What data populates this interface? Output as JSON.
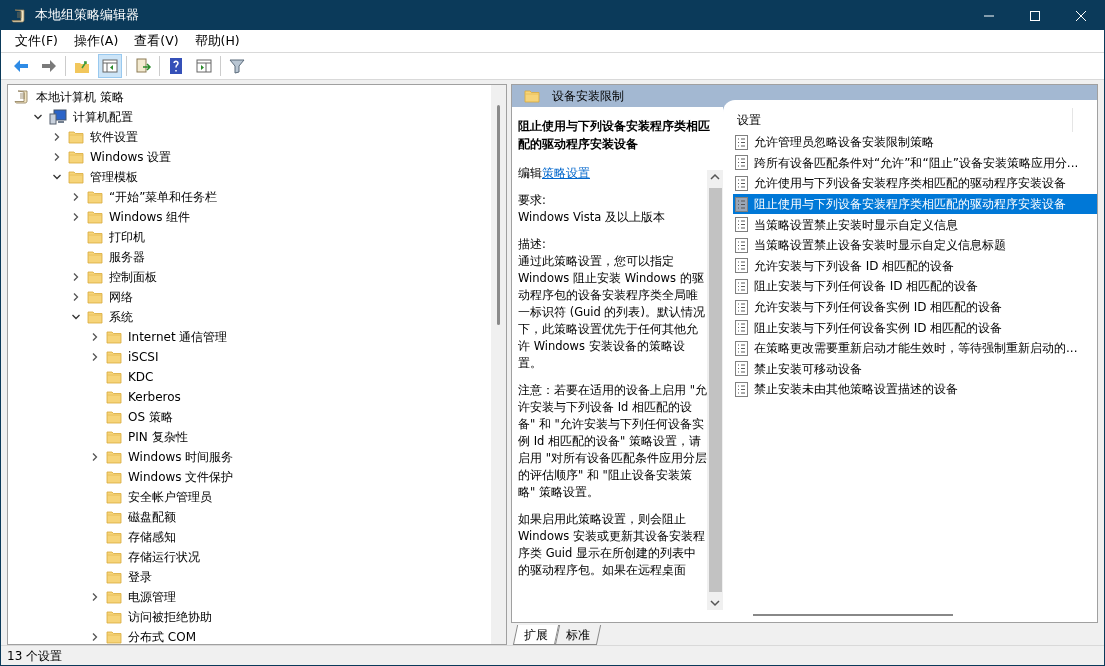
{
  "window": {
    "title": "本地组策略编辑器"
  },
  "menu": [
    "文件(F)",
    "操作(A)",
    "查看(V)",
    "帮助(H)"
  ],
  "tree": [
    {
      "label": "本地计算机 策略",
      "kind": "root",
      "children": [
        {
          "label": "计算机配置",
          "kind": "computer",
          "expanded": true,
          "children": [
            {
              "label": "软件设置",
              "kind": "folder",
              "expanded": false
            },
            {
              "label": "Windows 设置",
              "kind": "folder",
              "expanded": false
            },
            {
              "label": "管理模板",
              "kind": "folder",
              "expanded": true,
              "children": [
                {
                  "label": "“开始”菜单和任务栏",
                  "kind": "folder",
                  "expanded": false
                },
                {
                  "label": "Windows 组件",
                  "kind": "folder",
                  "expanded": false
                },
                {
                  "label": "打印机",
                  "kind": "folder"
                },
                {
                  "label": "服务器",
                  "kind": "folder"
                },
                {
                  "label": "控制面板",
                  "kind": "folder",
                  "expanded": false
                },
                {
                  "label": "网络",
                  "kind": "folder",
                  "expanded": false
                },
                {
                  "label": "系统",
                  "kind": "folder",
                  "expanded": true,
                  "children": [
                    {
                      "label": "Internet 通信管理",
                      "kind": "folder",
                      "expanded": false
                    },
                    {
                      "label": "iSCSI",
                      "kind": "folder",
                      "expanded": false
                    },
                    {
                      "label": "KDC",
                      "kind": "folder"
                    },
                    {
                      "label": "Kerberos",
                      "kind": "folder"
                    },
                    {
                      "label": "OS 策略",
                      "kind": "folder"
                    },
                    {
                      "label": "PIN 复杂性",
                      "kind": "folder"
                    },
                    {
                      "label": "Windows 时间服务",
                      "kind": "folder",
                      "expanded": false
                    },
                    {
                      "label": "Windows 文件保护",
                      "kind": "folder"
                    },
                    {
                      "label": "安全帐户管理员",
                      "kind": "folder"
                    },
                    {
                      "label": "磁盘配额",
                      "kind": "folder"
                    },
                    {
                      "label": "存储感知",
                      "kind": "folder"
                    },
                    {
                      "label": "存储运行状况",
                      "kind": "folder"
                    },
                    {
                      "label": "登录",
                      "kind": "folder"
                    },
                    {
                      "label": "电源管理",
                      "kind": "folder",
                      "expanded": false
                    },
                    {
                      "label": "访问被拒绝协助",
                      "kind": "folder"
                    },
                    {
                      "label": "分布式 COM",
                      "kind": "folder",
                      "expanded": false
                    }
                  ]
                }
              ]
            }
          ]
        }
      ]
    }
  ],
  "details": {
    "folder": "设备安装限制",
    "title": "阻止使用与下列设备安装程序类相匹配的驱动程序安装设备",
    "edit_prefix": "编辑",
    "edit_link": "策略设置",
    "sections": [
      {
        "heading": "要求:",
        "text": "Windows Vista 及以上版本"
      },
      {
        "heading": "描述:",
        "text": "通过此策略设置，您可以指定 Windows 阻止安装 Windows 的驱动程序包的设备安装程序类全局唯一标识符 (Guid 的列表)。默认情况下，此策略设置优先于任何其他允许 Windows 安装设备的策略设置。"
      },
      {
        "text": "注意：若要在适用的设备上启用 \"允许安装与下列设备 Id 相匹配的设备\" 和 \"允许安装与下列任何设备实例 Id 相匹配的设备\" 策略设置，请启用 \"对所有设备匹配条件应用分层的评估顺序\" 和 \"阻止设备安装策略\" 策略设置。"
      },
      {
        "text": "如果启用此策略设置，则会阻止 Windows 安装或更新其设备安装程序类 Guid 显示在所创建的列表中的驱动程序包。如果在远程桌面"
      }
    ]
  },
  "settings": {
    "column": "设置",
    "items": [
      {
        "label": "允许管理员忽略设备安装限制策略",
        "selected": false
      },
      {
        "label": "跨所有设备匹配条件对“允许”和“阻止”设备安装策略应用分...",
        "selected": false
      },
      {
        "label": "允许使用与下列设备安装程序类相匹配的驱动程序安装设备",
        "selected": false
      },
      {
        "label": "阻止使用与下列设备安装程序类相匹配的驱动程序安装设备",
        "selected": true
      },
      {
        "label": "当策略设置禁止安装时显示自定义信息",
        "selected": false
      },
      {
        "label": "当策略设置禁止设备安装时显示自定义信息标题",
        "selected": false
      },
      {
        "label": "允许安装与下列设备 ID 相匹配的设备",
        "selected": false
      },
      {
        "label": "阻止安装与下列任何设备 ID 相匹配的设备",
        "selected": false
      },
      {
        "label": "允许安装与下列任何设备实例 ID 相匹配的设备",
        "selected": false
      },
      {
        "label": "阻止安装与下列任何设备实例 ID 相匹配的设备",
        "selected": false
      },
      {
        "label": "在策略更改需要重新启动才能生效时，等待强制重新启动的...",
        "selected": false
      },
      {
        "label": "禁止安装可移动设备",
        "selected": false
      },
      {
        "label": "禁止安装未由其他策略设置描述的设备",
        "selected": false
      }
    ]
  },
  "tabs": [
    {
      "label": "扩展",
      "selected": true
    },
    {
      "label": "标准",
      "selected": false
    }
  ],
  "status_bar": "13 个设置"
}
